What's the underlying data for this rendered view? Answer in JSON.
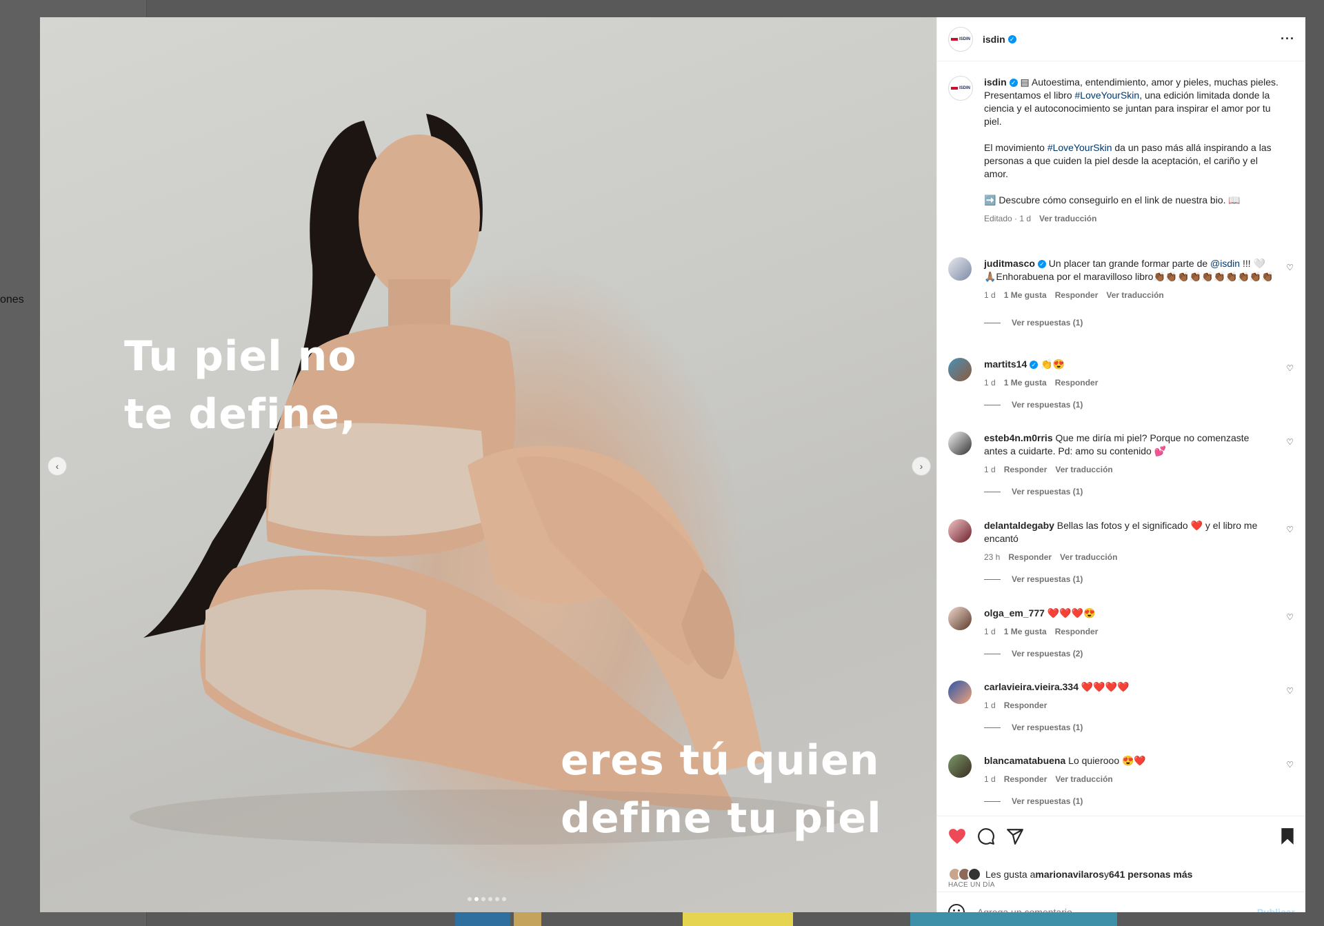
{
  "background": {
    "side_text": "ones"
  },
  "post": {
    "author": "isdin",
    "logo_text": "ISDIN",
    "slide_text_1": "Tu piel no\nte define,",
    "slide_text_2": "eres tú quien\ndefine tu piel",
    "carousel_dots": 6,
    "carousel_active": 1,
    "caption": {
      "author": "isdin",
      "p1_a": " ▤ Autoestima, entendimiento, amor y pieles, muchas pieles. Presentamos el libro ",
      "hashtag": "#LoveYourSkin",
      "p1_b": ", una edición limitada donde la ciencia y el autoconocimiento se juntan para inspirar el amor por tu piel.",
      "p2_a": "El movimiento ",
      "p2_b": " da un paso más allá inspirando a las personas a que cuiden la piel desde la aceptación, el cariño y el amor.",
      "p3": "➡️ Descubre cómo conseguirlo en el link de nuestra bio. 📖",
      "edited": "Editado · 1 d",
      "translate": "Ver traducción"
    }
  },
  "comments": [
    {
      "user": "juditmasco",
      "verified": true,
      "text_a": " Un placer tan grande formar parte de ",
      "mention": "@isdin",
      "text_b": " !!! 🤍🙏🏽Enhorabuena por el maravilloso libro👏🏾👏🏾👏🏾👏🏾👏🏾👏🏾👏🏾👏🏾👏🏾👏🏾",
      "time": "1 d",
      "likes": "1 Me gusta",
      "reply": "Responder",
      "translate": "Ver traducción",
      "replies": "Ver respuestas (1)"
    },
    {
      "user": "martits14",
      "verified": true,
      "text_a": " 👏😍",
      "time": "1 d",
      "likes": "1 Me gusta",
      "reply": "Responder",
      "replies": "Ver respuestas (1)"
    },
    {
      "user": "esteb4n.m0rris",
      "text_a": " Que me diría mi piel? Porque no comenzaste antes a cuidarte. Pd: amo su contenido 💕",
      "time": "1 d",
      "reply": "Responder",
      "translate": "Ver traducción",
      "replies": "Ver respuestas (1)"
    },
    {
      "user": "delantaldegaby",
      "text_a": " Bellas las fotos y el significado ❤️ y el libro me encantó",
      "time": "23 h",
      "reply": "Responder",
      "translate": "Ver traducción",
      "replies": "Ver respuestas (1)"
    },
    {
      "user": "olga_em_777",
      "text_a": " ❤️❤️❤️😍",
      "time": "1 d",
      "likes": "1 Me gusta",
      "reply": "Responder",
      "replies": "Ver respuestas (2)"
    },
    {
      "user": "carlavieira.vieira.334",
      "text_a": " ❤️❤️❤️❤️",
      "time": "1 d",
      "reply": "Responder",
      "replies": "Ver respuestas (1)"
    },
    {
      "user": "blancamatabuena",
      "text_a": " Lo quierooo 😍❤️",
      "time": "1 d",
      "reply": "Responder",
      "translate": "Ver traducción",
      "replies": "Ver respuestas (1)"
    }
  ],
  "footer": {
    "likes_prefix": "Les gusta a ",
    "likes_user": "marionavilaros",
    "likes_mid": " y ",
    "likes_count": "641 personas más",
    "time": "HACE UN DÍA",
    "comment_placeholder": "Agrega un comentario...",
    "publish": "Publicar"
  },
  "colors": {
    "accent": "#0095f6",
    "like": "#ed4956",
    "link": "#00376b"
  },
  "icons": [
    "heart-icon",
    "comment-icon",
    "share-icon",
    "bookmark-icon",
    "emoji-icon",
    "more-icon",
    "verified-icon",
    "chevron-left-icon",
    "chevron-right-icon"
  ]
}
